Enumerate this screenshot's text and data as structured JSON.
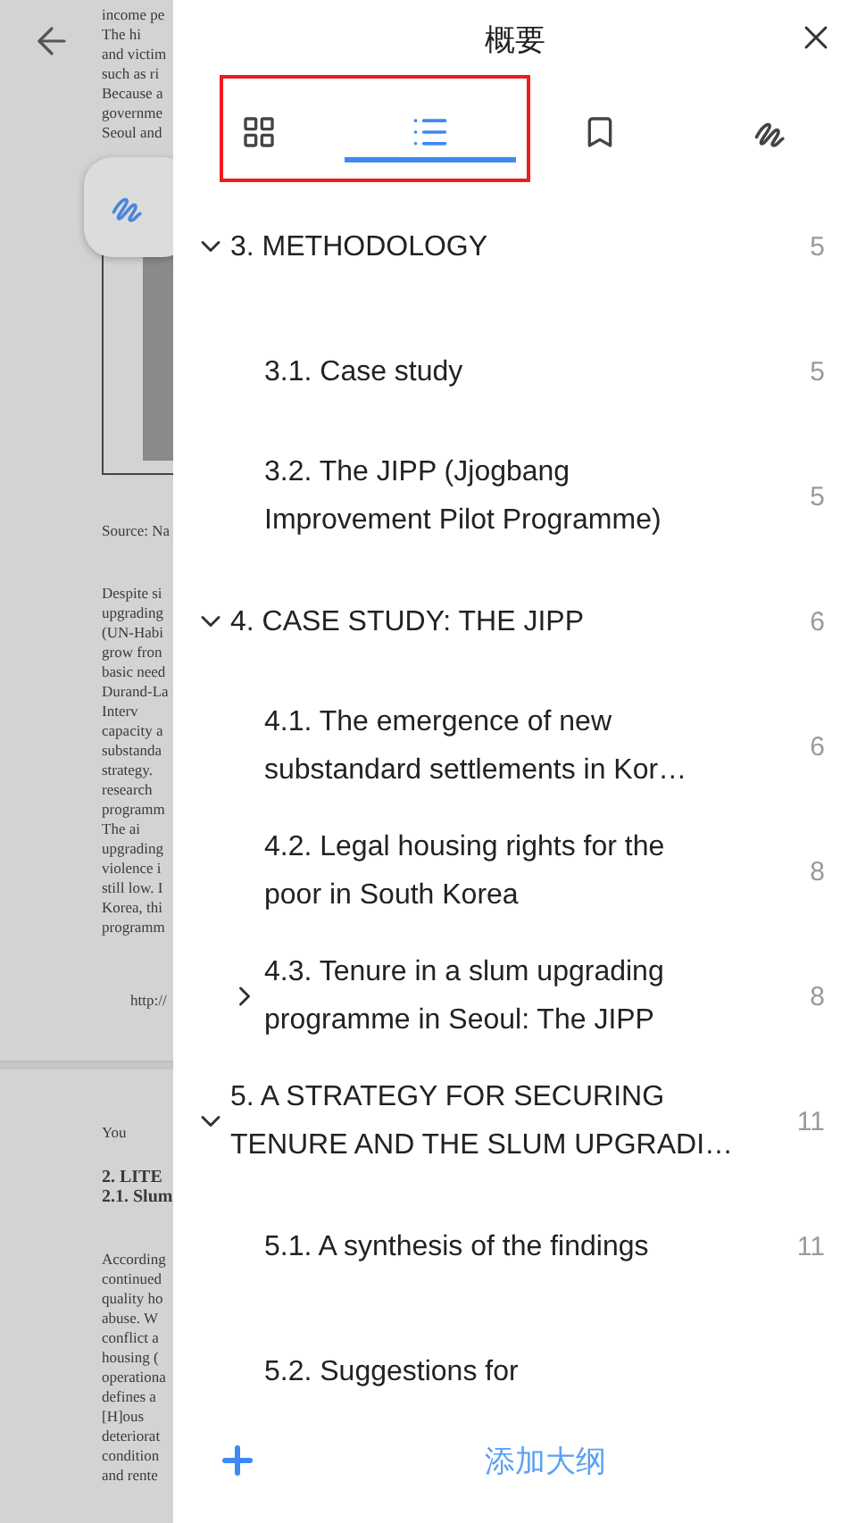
{
  "document": {
    "blocks": [
      {
        "kind": "text",
        "lines": [
          "income pe",
          "The hi",
          "and victim",
          "such as ri",
          "Because a",
          "governme",
          "Seoul and"
        ]
      },
      {
        "kind": "photo"
      },
      {
        "kind": "text",
        "lines": [
          "Source: Na"
        ]
      },
      {
        "kind": "text",
        "lines": [
          "Despite si",
          "upgrading",
          "(UN-Habi",
          "grow fron",
          "basic need",
          "Durand-La",
          "Interv",
          "capacity a",
          "substanda",
          "strategy.",
          "research",
          "programm",
          "The ai",
          "upgrading",
          "violence i",
          "still low. I",
          "Korea, thi",
          "programm"
        ]
      },
      {
        "kind": "link",
        "lines": [
          "http://"
        ]
      },
      {
        "kind": "pagebreak"
      },
      {
        "kind": "text",
        "lines": [
          "You"
        ]
      },
      {
        "kind": "heading",
        "lines": [
          "2. LITE",
          "2.1. Slum"
        ]
      },
      {
        "kind": "text",
        "lines": [
          "According",
          "continued",
          "quality ho",
          "abuse. W",
          "conflict a",
          "housing (",
          "operationa",
          "defines a",
          "[H]ous",
          "deteriorat",
          "condition",
          "and rente"
        ]
      }
    ]
  },
  "panel": {
    "title": "概要",
    "tabs": [
      {
        "kind": "thumbnails",
        "selected": false
      },
      {
        "kind": "outline",
        "selected": true
      },
      {
        "kind": "bookmarks",
        "selected": false
      },
      {
        "kind": "annotations",
        "selected": false
      }
    ],
    "outline": [
      {
        "title": "3. METHODOLOGY",
        "page": "5",
        "expanded": true,
        "children": [
          {
            "title": "3.1. Case study",
            "page": "5"
          },
          {
            "title": "3.2. The JIPP (Jjogbang Improvement Pilot Programme)",
            "page": "5"
          }
        ]
      },
      {
        "title": "4. CASE STUDY: THE JIPP",
        "page": "6",
        "expanded": true,
        "children": [
          {
            "title": "4.1. The emergence of new substandard settlements in Kor…",
            "page": "6"
          },
          {
            "title": "4.2. Legal housing rights for the poor in South Korea",
            "page": "8"
          },
          {
            "title": "4.3. Tenure in a slum upgrading programme in Seoul: The JIPP",
            "page": "8",
            "expanded": false
          }
        ]
      },
      {
        "title": "5. A STRATEGY FOR SECURING TENURE AND THE SLUM UPGRADI…",
        "page": "11",
        "expanded": true,
        "children": [
          {
            "title": "5.1. A synthesis of the findings",
            "page": "11"
          },
          {
            "title": "5.2. Suggestions for"
          }
        ]
      }
    ],
    "add_label": "添加大纲"
  }
}
